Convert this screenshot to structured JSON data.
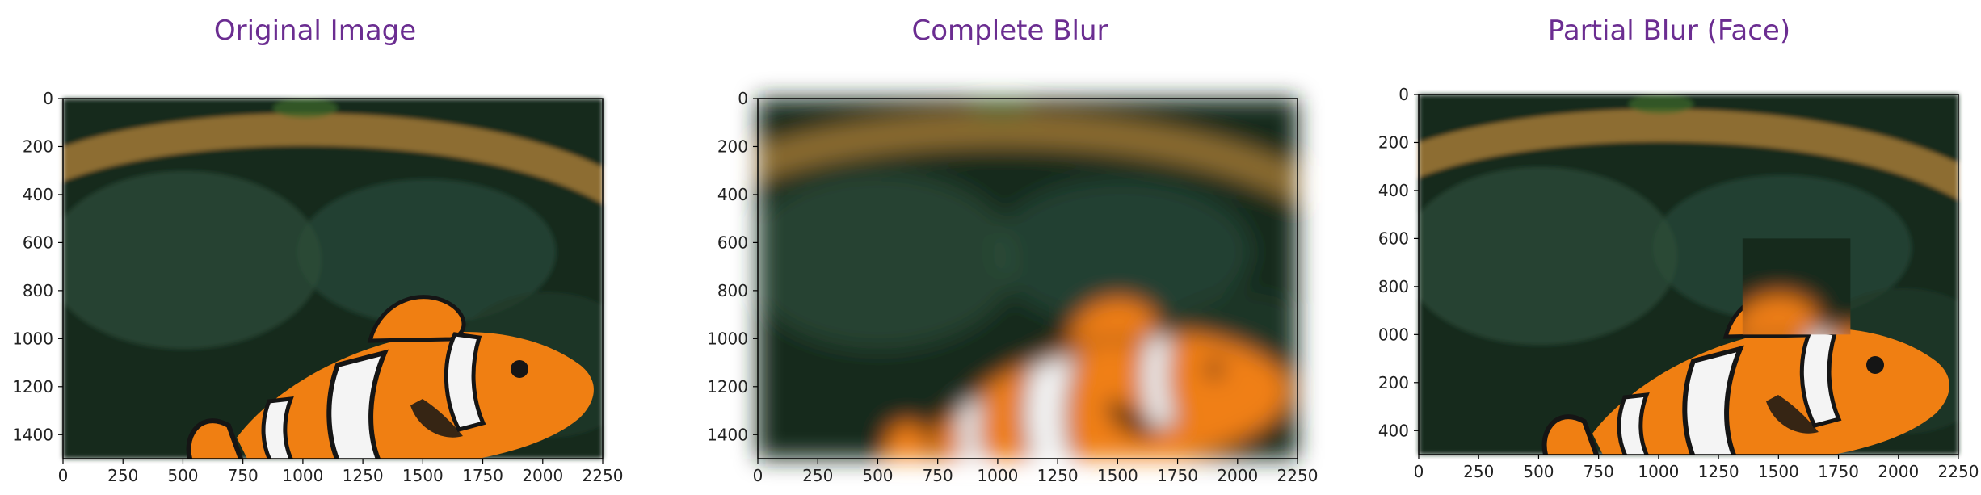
{
  "chart_data": [
    {
      "type": "image",
      "title": "Original Image",
      "image_content": "clownfish",
      "blur": "none",
      "xlim": [
        0,
        2250
      ],
      "ylim_top_to_bottom": [
        0,
        1500
      ],
      "x_ticks": [
        "0",
        "250",
        "500",
        "750",
        "1000",
        "1250",
        "1500",
        "1750",
        "2000",
        "2250"
      ],
      "y_ticks": [
        "0",
        "200",
        "400",
        "600",
        "800",
        "1000",
        "1200",
        "1400"
      ],
      "title_color": "#6b2d91"
    },
    {
      "type": "image",
      "title": "Complete Blur",
      "image_content": "clownfish",
      "blur": "full",
      "xlim": [
        0,
        2250
      ],
      "ylim_top_to_bottom": [
        0,
        1500
      ],
      "x_ticks": [
        "0",
        "250",
        "500",
        "750",
        "1000",
        "1250",
        "1500",
        "1750",
        "2000",
        "2250"
      ],
      "y_ticks": [
        "0",
        "200",
        "400",
        "600",
        "800",
        "1000",
        "1200",
        "1400"
      ],
      "title_color": "#6b2d91"
    },
    {
      "type": "image",
      "title": "Partial Blur (Face)",
      "image_content": "clownfish",
      "blur": "face-region",
      "xlim": [
        0,
        2250
      ],
      "ylim_top_to_bottom": [
        0,
        1500
      ],
      "x_ticks": [
        "0",
        "250",
        "500",
        "750",
        "1000",
        "1250",
        "1500",
        "1750",
        "2000",
        "2250"
      ],
      "y_ticks": [
        "0",
        "200",
        "400",
        "600",
        "800",
        "000",
        "200",
        "400"
      ],
      "title_color": "#6b2d91"
    }
  ],
  "colors": {
    "title": "#6b2d91",
    "water_dark": "#16291f",
    "water_mid": "#2b4a38",
    "rope": "#9a7432",
    "fish_orange": "#f07f12",
    "fish_white": "#f4f4f4",
    "fish_black": "#151515"
  }
}
